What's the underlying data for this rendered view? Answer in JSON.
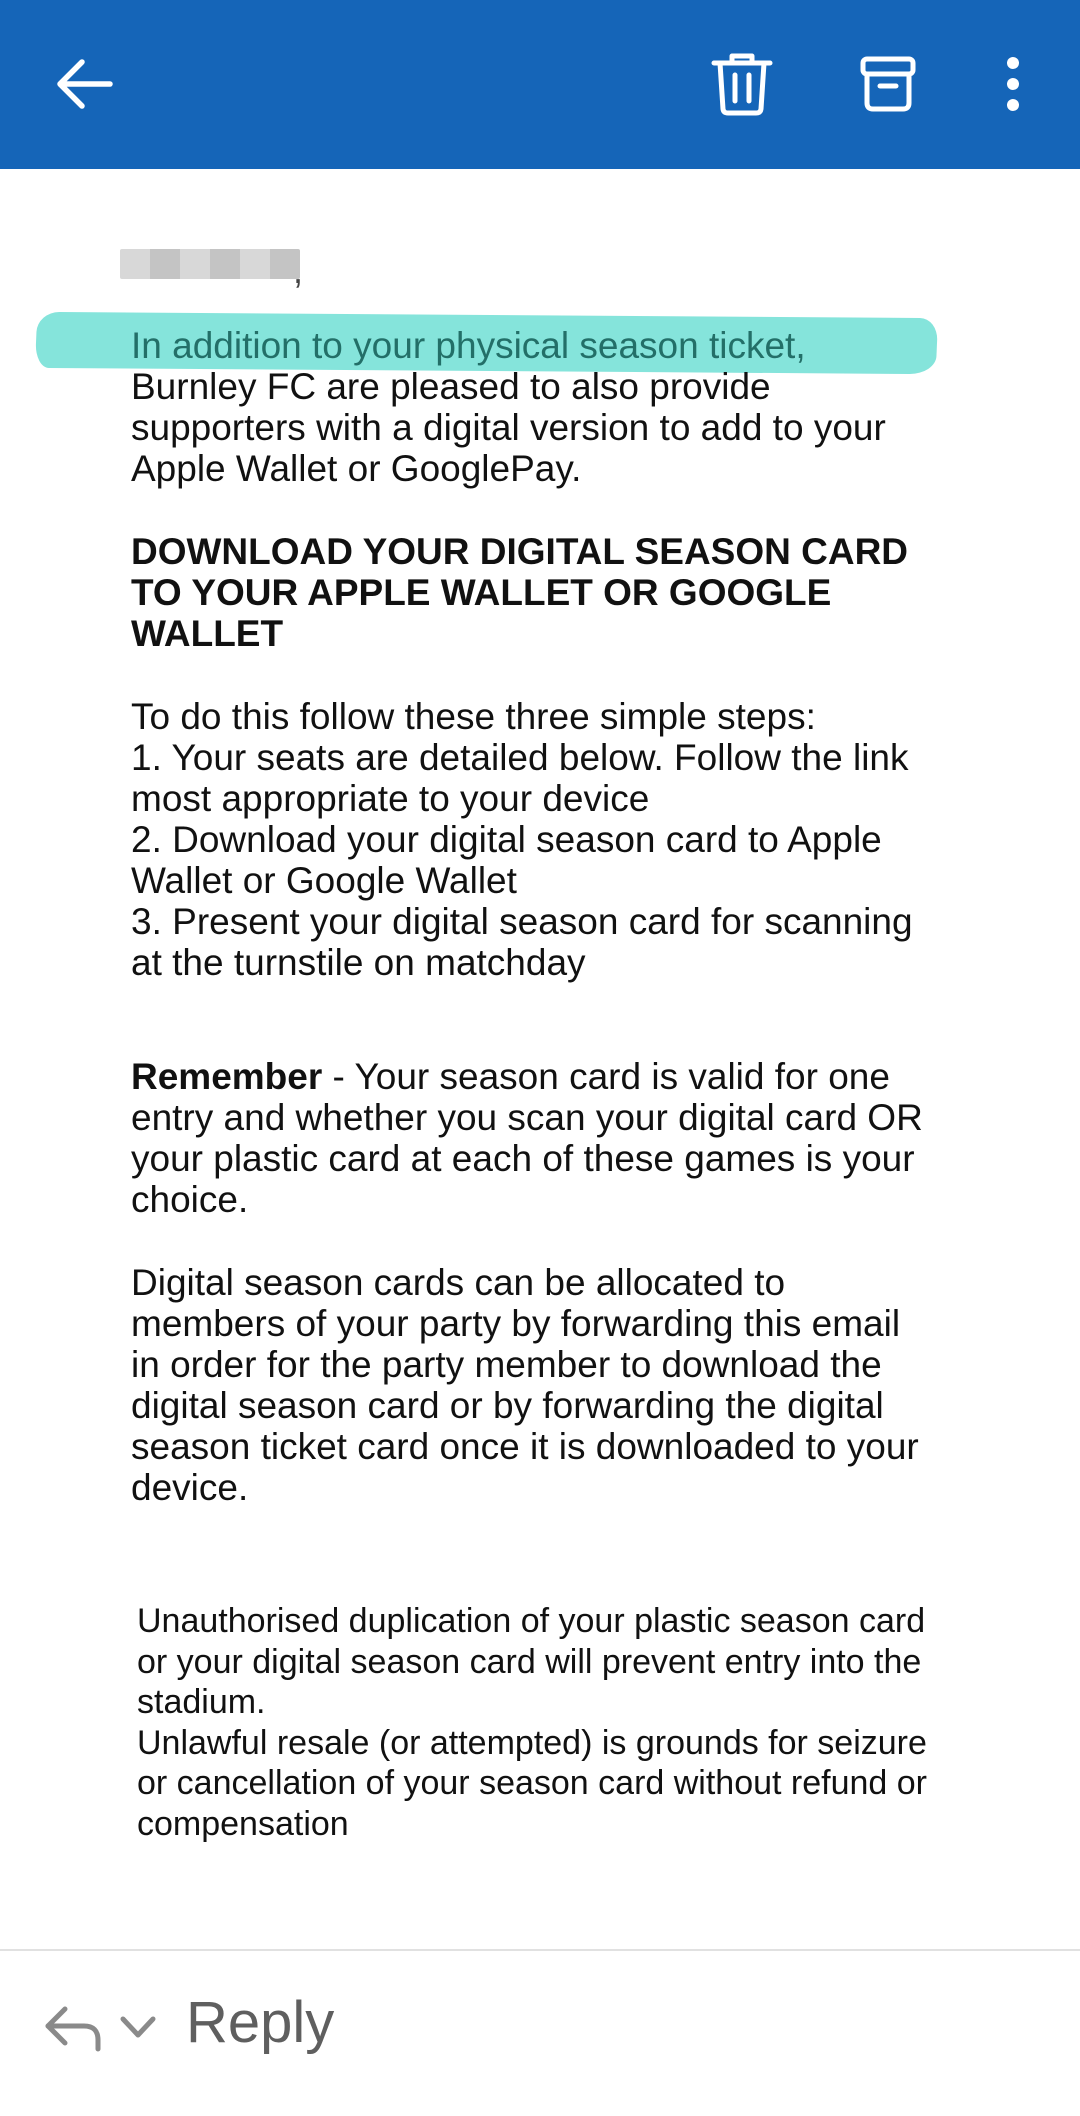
{
  "toolbar": {
    "background_color": "#1565b8",
    "icons": [
      "back-arrow-icon",
      "trash-icon",
      "archive-icon",
      "more-vertical-icon"
    ]
  },
  "email": {
    "greeting_suffix": ",",
    "intro_first_line": "In addition to your physical season ticket,",
    "intro_rest": "Burnley FC are pleased to also provide\nsupporters with a digital version to add to your\nApple Wallet or GooglePay.",
    "heading": "DOWNLOAD YOUR DIGITAL SEASON CARD\nTO YOUR APPLE WALLET OR GOOGLE\nWALLET",
    "steps": "To do this follow these three simple steps:\n1.  Your seats are detailed below.  Follow the link\nmost appropriate to your device\n2.  Download your digital season card to Apple\nWallet or Google Wallet\n3.  Present your digital season card for scanning\nat the turnstile on matchday",
    "remember_label": "Remember",
    "remember_text": " - Your season card is valid for one\nentry and whether you scan your digital card OR\nyour plastic card at each of these games is your\nchoice.",
    "allocate_text": "Digital season cards can be allocated to\nmembers of your party by forwarding this email\nin order for the party member to download the\ndigital season card or by forwarding the digital\nseason ticket card once it is downloaded to your\ndevice.",
    "disclaimer": "Unauthorised duplication of your plastic season card\nor your digital season card will prevent entry into the\nstadium.\nUnlawful resale (or attempted) is grounds for seizure\nor cancellation of your season card without refund or\ncompensation",
    "highlight_color": "#7ee3d9"
  },
  "reply_bar": {
    "reply_label": "Reply"
  }
}
